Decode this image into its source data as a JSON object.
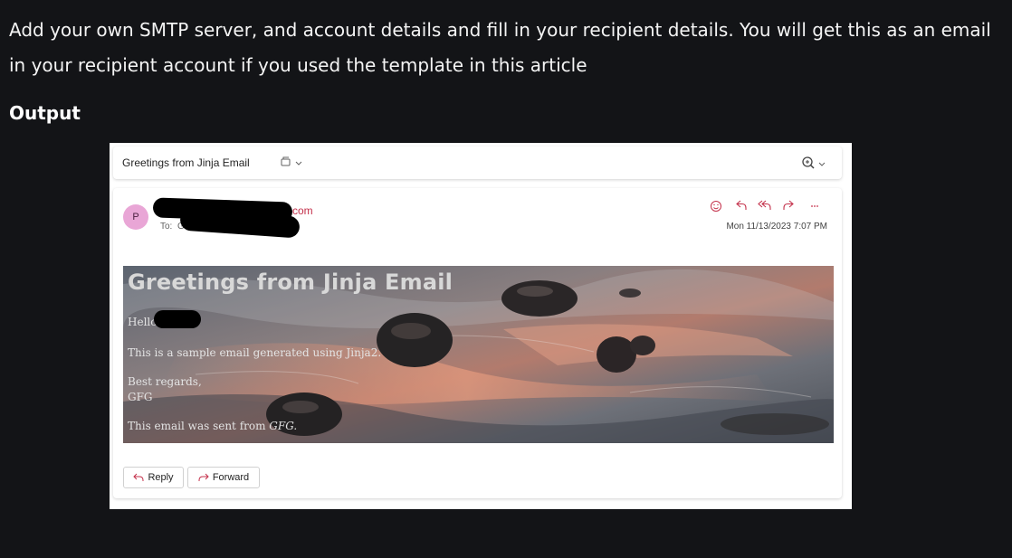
{
  "article": {
    "intro_text": "Add your own SMTP server, and account details and fill in your recipient details. You will get this as an email in your recipient account if you used the template in this article",
    "output_heading": "Output"
  },
  "mail_view": {
    "subject": "Greetings from Jinja Email",
    "sender_avatar_initial": "P",
    "sender_visible_tail": "com",
    "to_label": "To:",
    "to_visible_char": "G",
    "date": "Mon 11/13/2023 7:07 PM",
    "icons": {
      "subject_tag": "tag-icon",
      "zoom": "zoom-icon",
      "emoji": "emoji-icon",
      "reply": "reply-icon",
      "reply_all": "reply-all-icon",
      "forward": "forward-icon",
      "more": "more-icon"
    },
    "accent_color": "#c4314b",
    "avatar_color": "#e9a6d6",
    "email": {
      "heading": "Greetings from Jinja Email",
      "greeting": "Hello",
      "body": "This is a sample email generated using Jinja2.",
      "closing": "Best regards,",
      "signer": "GFG",
      "footer_prefix": "This email was sent from ",
      "footer_brand": "GFG."
    },
    "reply_label": "Reply",
    "forward_label": "Forward"
  }
}
